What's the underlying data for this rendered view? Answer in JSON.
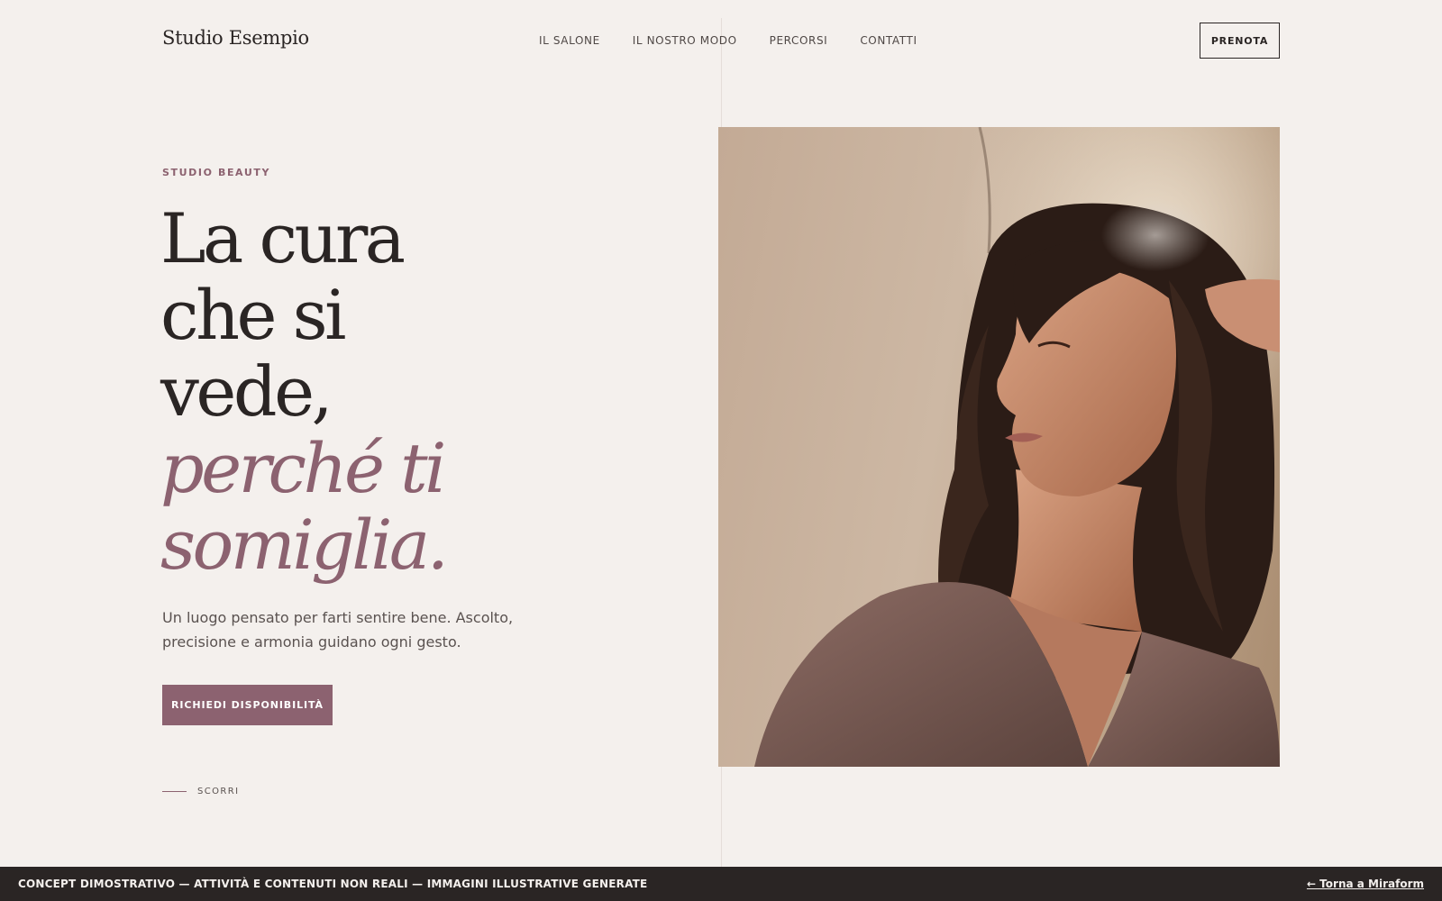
{
  "header": {
    "brand": "Studio Esempio",
    "nav": [
      {
        "label": "IL SALONE"
      },
      {
        "label": "IL NOSTRO MODO"
      },
      {
        "label": "PERCORSI"
      },
      {
        "label": "CONTATTI"
      }
    ],
    "cta_label": "PRENOTA"
  },
  "hero": {
    "eyebrow": "STUDIO BEAUTY",
    "headline_lines": [
      "La cura",
      "che si",
      "vede,"
    ],
    "headline_accent_lines": [
      "perché ti",
      "somiglia."
    ],
    "lead": "Un luogo pensato per farti sentire bene. Ascolto, precisione e armonia guidano ogni gesto.",
    "cta_label": "RICHIEDI DISPONIBILITÀ",
    "scroll_label": "SCORRI",
    "image_subject": "woman-portrait"
  },
  "footer": {
    "note": "CONCEPT DIMOSTRATIVO — ATTIVITÀ E CONTENUTI NON REALI — IMMAGINI ILLUSTRATIVE GENERATE",
    "back_link": "← Torna a Miraform"
  },
  "colors": {
    "background": "#f4f0ed",
    "text": "#2a2524",
    "accent": "#8c6270",
    "footer_bg": "#2a2524"
  }
}
